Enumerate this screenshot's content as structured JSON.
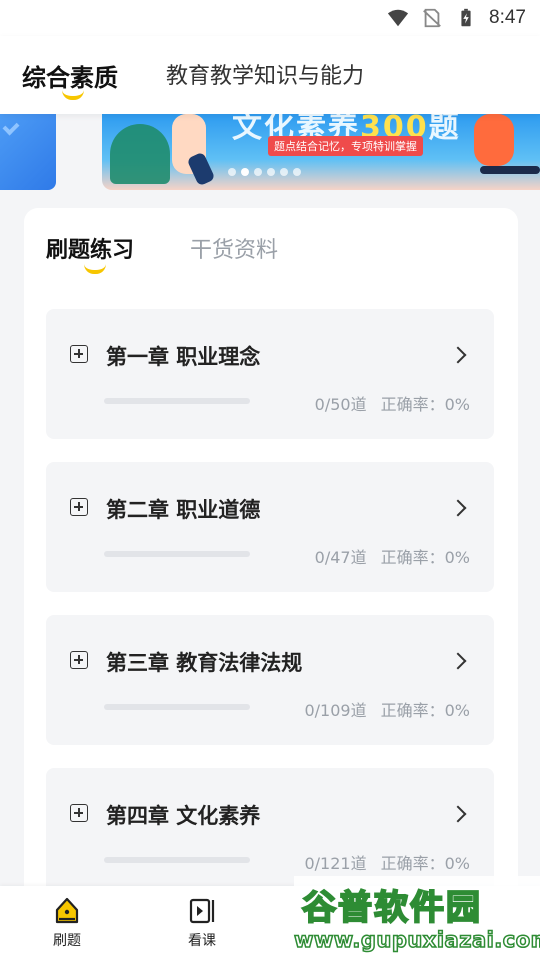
{
  "status_bar": {
    "time": "8:47"
  },
  "top_tabs": [
    {
      "label": "综合素质",
      "active": true
    },
    {
      "label": "教育教学知识与能力",
      "active": false
    }
  ],
  "banner": {
    "title_prefix": "文化素养",
    "title_highlight": "300",
    "title_suffix": "题",
    "subtitle": "题点结合记忆，专项特训掌握",
    "dots": 6,
    "active_dot": 1
  },
  "sub_tabs": [
    {
      "label": "刷题练习",
      "active": true
    },
    {
      "label": "干货资料",
      "active": false
    }
  ],
  "chapters": [
    {
      "title": "第一章 职业理念",
      "count": "0/50道",
      "accuracy": "正确率：0%",
      "progress": 0
    },
    {
      "title": "第二章 职业道德",
      "count": "0/47道",
      "accuracy": "正确率：0%",
      "progress": 0
    },
    {
      "title": "第三章 教育法律法规",
      "count": "0/109道",
      "accuracy": "正确率：0%",
      "progress": 0
    },
    {
      "title": "第四章 文化素养",
      "count": "0/121道",
      "accuracy": "正确率：0%",
      "progress": 0
    }
  ],
  "bottom_nav": [
    {
      "label": "刷题",
      "icon": "practice-icon",
      "active": true
    },
    {
      "label": "看课",
      "icon": "video-icon",
      "active": false
    }
  ],
  "watermark": {
    "title": "谷普软件园",
    "url": "www.gupuxiazai.com"
  },
  "colors": {
    "accent": "#f7c600",
    "card_bg": "#f4f5f7"
  }
}
